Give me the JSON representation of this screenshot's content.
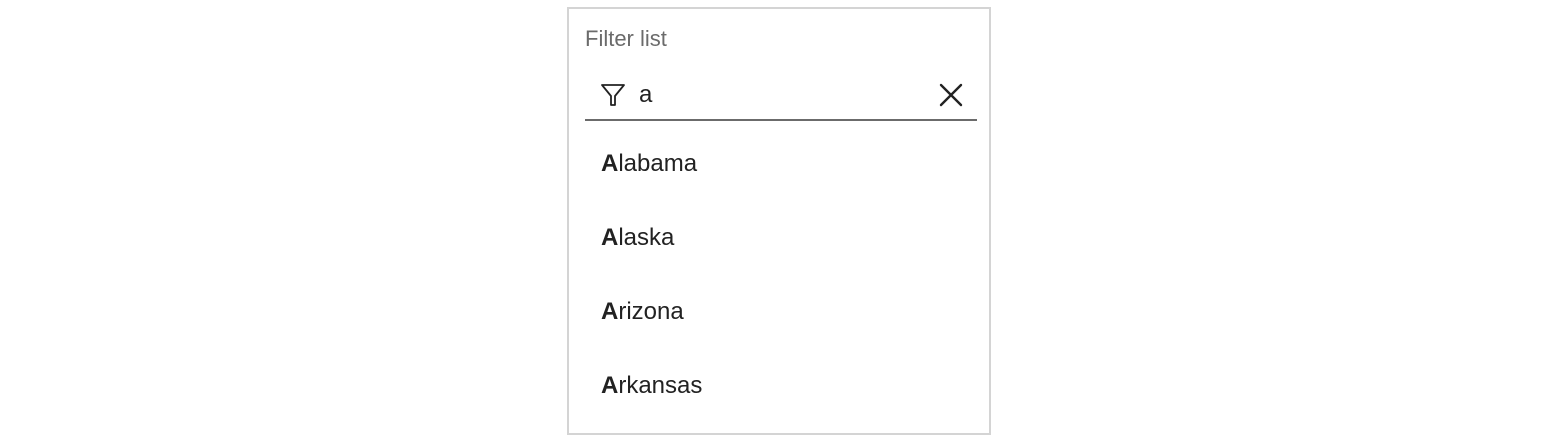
{
  "filter": {
    "label": "Filter list",
    "value": "a",
    "icon": "filter-icon",
    "clear_icon": "close-icon"
  },
  "results": [
    {
      "match": "A",
      "rest": "labama"
    },
    {
      "match": "A",
      "rest": "laska"
    },
    {
      "match": "A",
      "rest": "rizona"
    },
    {
      "match": "A",
      "rest": "rkansas"
    }
  ],
  "colors": {
    "border": "#d4d4d4",
    "label": "#6b6b6b",
    "text": "#222222"
  }
}
